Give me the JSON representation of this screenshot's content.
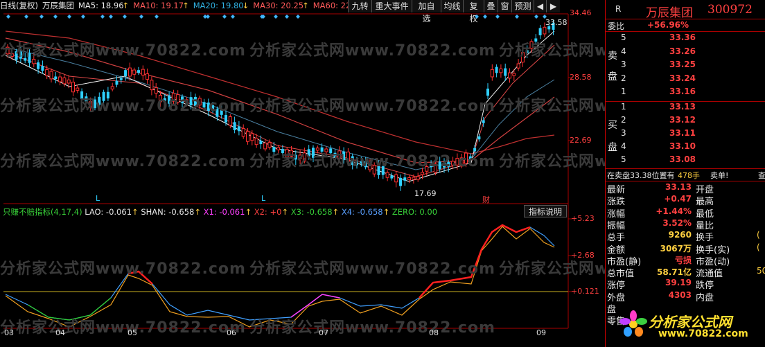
{
  "header": {
    "period_label": "日线(复权)",
    "stock_name": "万辰集团",
    "ma5": "MA5: 18.96",
    "ma10": "MA10: 19.17",
    "ma20": "MA20: 19.80",
    "ma30": "MA30: 20.25",
    "ma60": "MA60: 22.",
    "buttons": [
      "九转",
      "重大事件",
      "加自选",
      "均线",
      "复权",
      "叠",
      "窗",
      "预测",
      "◀",
      "▶"
    ]
  },
  "price_chart": {
    "y_ticks": [
      "34.46",
      "28.58",
      "22.69"
    ],
    "high_label": "33.58",
    "low_label": "17.69",
    "markers": [
      "L",
      "L",
      "财"
    ]
  },
  "indicator": {
    "title": "只赚不赔指标(4,17,4)",
    "lao": "LAO: -0.061",
    "shan": "SHAN: -0.658",
    "x1": "X1: -0.061",
    "x2": "X2: +0",
    "x3": "X3: -0.658",
    "x4": "X4: -0.658",
    "zero": "ZERO: 0.00",
    "help_button": "指标说明",
    "y_ticks": [
      "+5.23",
      "+2.68",
      "+0.121"
    ]
  },
  "date_axis": [
    "03",
    "04",
    "05",
    "06",
    "07",
    "08",
    "09"
  ],
  "watermark": "分析家公式网www.70822.com",
  "panel": {
    "r_label": "R",
    "title_name": "万辰集团",
    "title_code": "300972",
    "weibi_label": "委比",
    "weibi_value": "+56.96%",
    "sell_label": [
      "卖",
      "盘"
    ],
    "buy_label": [
      "买",
      "盘"
    ],
    "sell": [
      {
        "level": "5",
        "price": "33.36"
      },
      {
        "level": "4",
        "price": "33.26"
      },
      {
        "level": "3",
        "price": "33.25"
      },
      {
        "level": "2",
        "price": "33.24"
      },
      {
        "level": "1",
        "price": "33.16"
      }
    ],
    "buy": [
      {
        "level": "1",
        "price": "33.13"
      },
      {
        "level": "2",
        "price": "33.12"
      },
      {
        "level": "3",
        "price": "33.11"
      },
      {
        "level": "4",
        "price": "33.10"
      },
      {
        "level": "5",
        "price": "33.08"
      }
    ],
    "notice_text": "在卖盘33.38位置有",
    "notice_qty": "478手",
    "notice_action": "卖单!",
    "notice_extra": "查",
    "stats": [
      {
        "l1": "最新",
        "v1": "33.13",
        "l2": "开盘",
        "v2": ""
      },
      {
        "l1": "涨跌",
        "v1": "+0.47",
        "l2": "最高",
        "v2": ""
      },
      {
        "l1": "涨幅",
        "v1": "+1.44%",
        "l2": "最低",
        "v2": ""
      },
      {
        "l1": "振幅",
        "v1": "3.52%",
        "l2": "量比",
        "v2": ""
      },
      {
        "l1": "总手",
        "v1": "9260",
        "l2": "换手",
        "v2": "("
      },
      {
        "l1": "金额",
        "v1": "3067万",
        "l2": "换手(实)",
        "v2": "("
      },
      {
        "l1": "市盈(静)",
        "v1": "亏损",
        "l2": "市盈(动)",
        "v2": ""
      },
      {
        "l1": "总市值",
        "v1": "58.71亿",
        "l2": "流通值",
        "v2": "50."
      },
      {
        "l1": "涨停",
        "v1": "39.19",
        "l2": "跌停",
        "v2": ""
      },
      {
        "l1": "外盘",
        "v1": "4303",
        "l2": "内盘",
        "v2": ""
      },
      {
        "l1": "盘",
        "v1": "",
        "l2": "",
        "v2": ""
      },
      {
        "l1": "零售",
        "v1": "",
        "l2": "",
        "v2": ""
      }
    ],
    "logo_text": "分析家公式网",
    "logo_url": "www.70822.com"
  },
  "colors": {
    "up": "#ff3030",
    "down": "#2fd0ff",
    "grid": "#a00000"
  }
}
